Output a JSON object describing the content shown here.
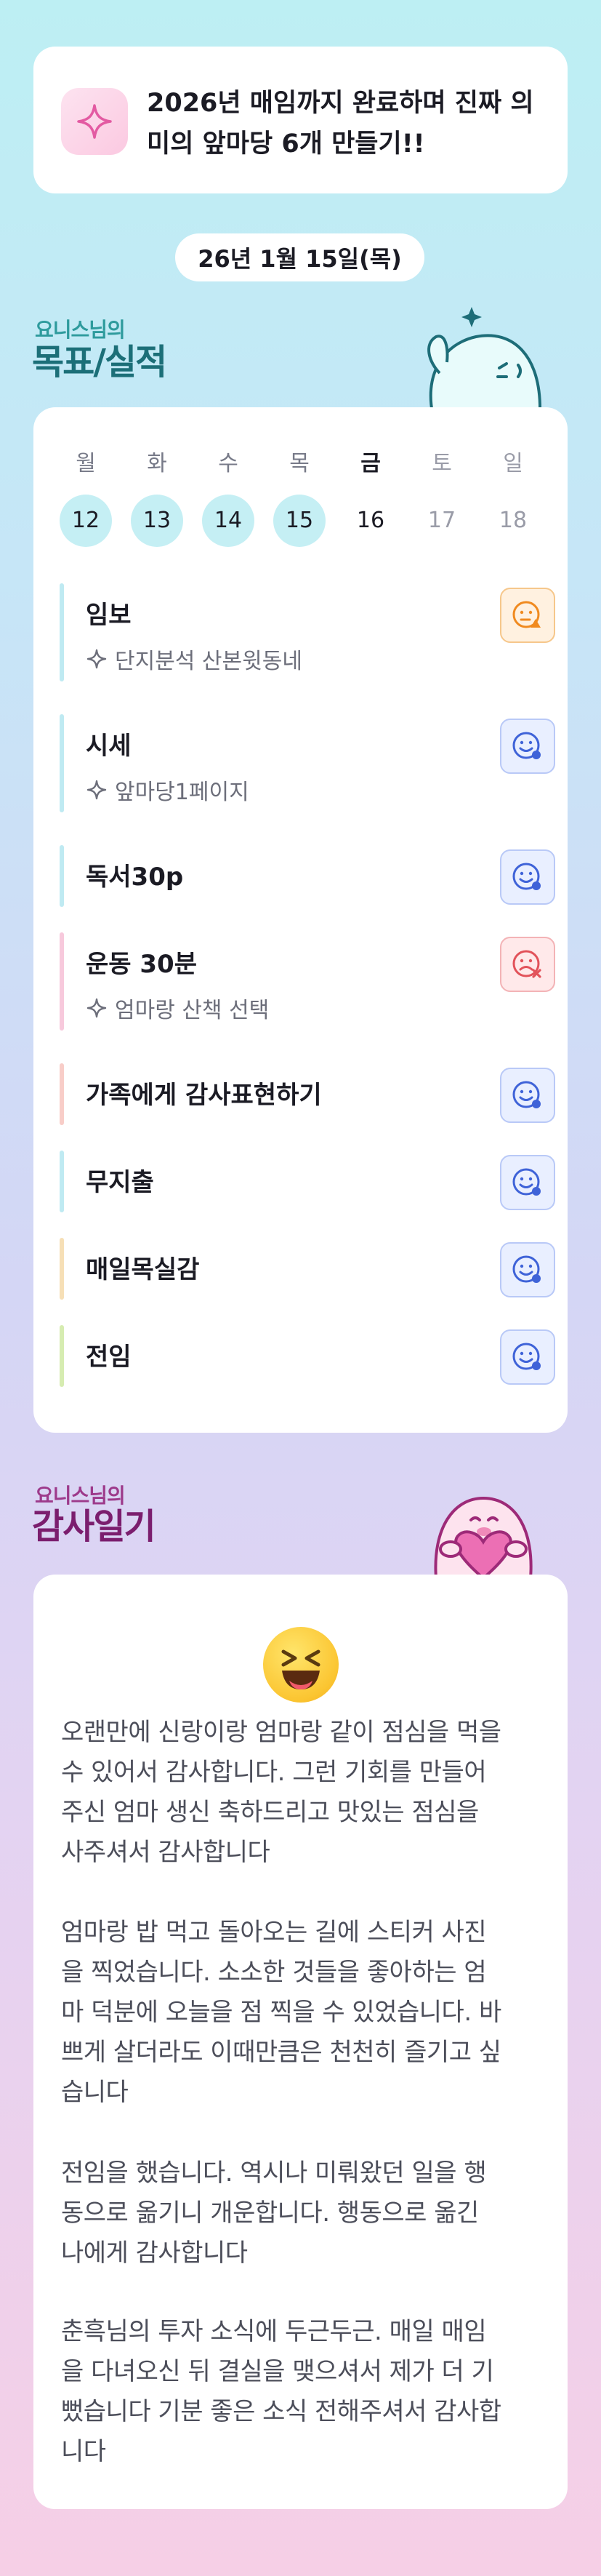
{
  "goal": {
    "text": "2026년 매임까지 완료하며 진짜 의미의 앞마당 6개 만들기!!",
    "icon": "sparkle-icon"
  },
  "date_label": "26년 1월 15일(목)",
  "goals_section": {
    "owner": "요니스님의",
    "title": "목표/실적"
  },
  "week": [
    {
      "name": "월",
      "num": "12",
      "state": "done"
    },
    {
      "name": "화",
      "num": "13",
      "state": "done"
    },
    {
      "name": "수",
      "num": "14",
      "state": "done"
    },
    {
      "name": "목",
      "num": "15",
      "state": "done"
    },
    {
      "name": "금",
      "num": "16",
      "state": "today"
    },
    {
      "name": "토",
      "num": "17",
      "state": "future"
    },
    {
      "name": "일",
      "num": "18",
      "state": "future"
    }
  ],
  "tasks": [
    {
      "title": "임보",
      "sub": "단지분석 산본윗동네",
      "bar": "#bfeaf2",
      "status": "warn"
    },
    {
      "title": "시세",
      "sub": "앞마당1페이지",
      "bar": "#bfeaf2",
      "status": "ok"
    },
    {
      "title": "독서30p",
      "sub": "",
      "bar": "#bfeaf2",
      "status": "ok"
    },
    {
      "title": "운동 30분",
      "sub": "엄마랑 산책 선택",
      "bar": "#f7c9dc",
      "status": "bad"
    },
    {
      "title": "가족에게 감사표현하기",
      "sub": "",
      "bar": "#f8cdc8",
      "status": "ok"
    },
    {
      "title": "무지출",
      "sub": "",
      "bar": "#bfeaf2",
      "status": "ok"
    },
    {
      "title": "매일목실감",
      "sub": "",
      "bar": "#f6dfb6",
      "status": "ok"
    },
    {
      "title": "전임",
      "sub": "",
      "bar": "#d6ecb1",
      "status": "ok"
    }
  ],
  "thanks_section": {
    "owner": "요니스님의",
    "title": "감사일기"
  },
  "thanks": {
    "emoji": "laughing-face-icon",
    "paragraphs": [
      [
        "오랜만에 신랑이랑 엄마랑 같이 점심을 먹을",
        "수 있어서 감사합니다. 그런 기회를 만들어",
        "주신 엄마 생신 축하드리고 맛있는 점심을",
        "사주셔서 감사합니다"
      ],
      [
        "엄마랑 밥 먹고 돌아오는 길에 스티커 사진",
        "을 찍었습니다. 소소한 것들을 좋아하는 엄",
        "마 덕분에 오늘을 점 찍을 수 있었습니다. 바",
        "쁘게 살더라도 이때만큼은 천천히 즐기고 싶",
        "습니다"
      ],
      [
        "전임을 했습니다. 역시나 미뤄왔던 일을 행",
        "동으로 옮기니 개운합니다. 행동으로 옮긴",
        "나에게 감사합니다"
      ],
      [
        "춘흑님의 투자 소식에 두근두근. 매일 매임",
        "을 다녀오신 뒤 결실을 맺으셔서 제가 더 기",
        "뻤습니다 기분 좋은 소식 전해주셔서 감사합",
        "니다"
      ]
    ]
  },
  "colors": {
    "teal_title": "#1c6f78",
    "purple_title": "#7b1e6e",
    "status_ok": "#3f63d8",
    "status_warn": "#f08a1f",
    "status_bad": "#e2525a"
  }
}
